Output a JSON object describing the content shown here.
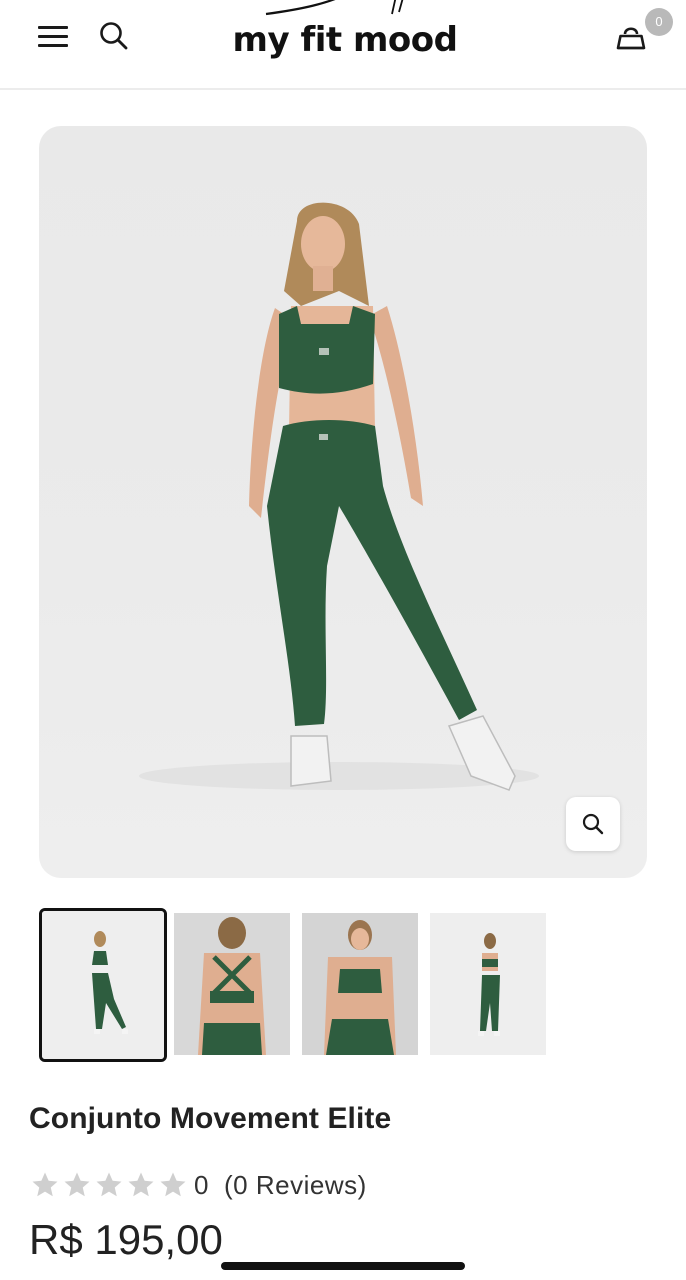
{
  "header": {
    "logo": "my fit mood",
    "cart_count": "0"
  },
  "product": {
    "title": "Conjunto Movement Elite",
    "rating": "0",
    "reviews": "(0 Reviews)",
    "price": "R$ 195,00",
    "stars_filled": 0,
    "stars_total": 5
  },
  "gallery": {
    "thumbnails": [
      "front-full-body",
      "back-top",
      "front-torso",
      "back-full-body"
    ],
    "active_index": 0
  },
  "colors": {
    "garment_green": "#2e5d3f",
    "star_gray": "#cfcfcf",
    "text": "#222222"
  },
  "icons": [
    "menu-icon",
    "search-icon",
    "cart-icon",
    "zoom-icon",
    "star-icon"
  ]
}
